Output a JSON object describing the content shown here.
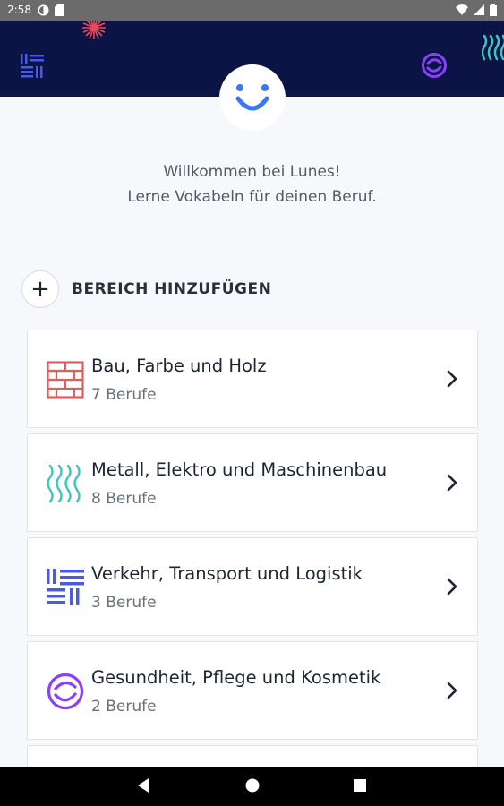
{
  "status_bar": {
    "time": "2:58",
    "icons": [
      "notification-icon",
      "sd-card-icon",
      "wifi-icon",
      "signal-icon",
      "battery-icon"
    ]
  },
  "header": {
    "left_icon": "transport-lines-icon",
    "right_icon": "health-swirl-icon",
    "logo": "smiley-logo-icon",
    "colors": {
      "background": "#0b1445",
      "accent_red": "#e8495b",
      "accent_teal": "#3cc6c0",
      "accent_purple": "#8a3ffc"
    }
  },
  "welcome": {
    "line1": "Willkommen bei Lunes!",
    "line2": "Lerne Vokabeln für deinen Beruf."
  },
  "add_section": {
    "label": "BEREICH HINZUFÜGEN"
  },
  "disciplines": [
    {
      "title": "Bau, Farbe und Holz",
      "subtitle": "7 Berufe",
      "icon": "brick-wall-icon",
      "color": "#e35d5b"
    },
    {
      "title": "Metall, Elektro und Maschinenbau",
      "subtitle": "8 Berufe",
      "icon": "wave-lines-icon",
      "color": "#3cc6c0"
    },
    {
      "title": "Verkehr, Transport und Logistik",
      "subtitle": "3 Berufe",
      "icon": "transport-lines-icon",
      "color": "#4a5be0"
    },
    {
      "title": "Gesundheit, Pflege und Kosmetik",
      "subtitle": "2 Berufe",
      "icon": "health-swirl-icon",
      "color": "#8a3ffc"
    }
  ]
}
